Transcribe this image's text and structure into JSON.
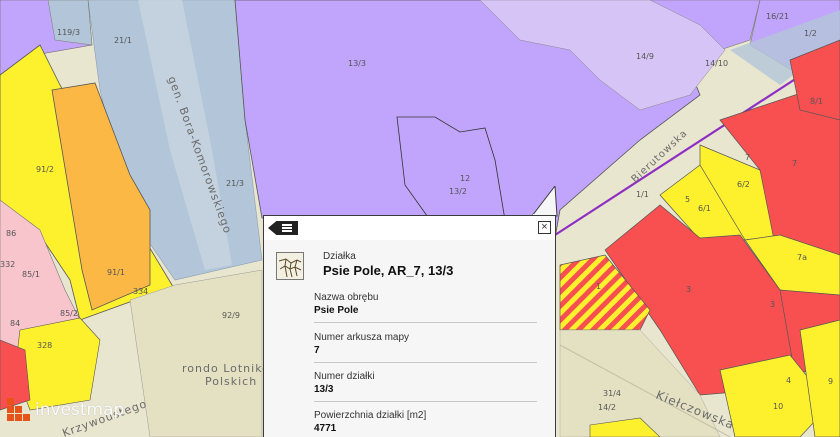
{
  "map": {
    "parcel_labels": [
      "119/3",
      "21/1",
      "13/3",
      "14/9",
      "14/10",
      "16/21",
      "1/2",
      "91/2",
      "21/3",
      "12",
      "13/2",
      "91/1",
      "334",
      "86",
      "332",
      "85/1",
      "84",
      "85/2",
      "328",
      "92/9",
      "7",
      "6/2",
      "5",
      "6/1",
      "1/1",
      "7a",
      "1",
      "3",
      "3",
      "4",
      "10",
      "31/4",
      "14/2",
      "8/1",
      "9"
    ],
    "streets": [
      "gen. Bora-Komorowskiego",
      "Bierutowska",
      "Kiełczowska",
      "rondo Lotników",
      "Polskich",
      "Krzywoustego"
    ]
  },
  "popup": {
    "category": "Działka",
    "title": "Psie Pole, AR_7, 13/3",
    "fields": [
      {
        "key": "Nazwa obrębu",
        "value": "Psie Pole"
      },
      {
        "key": "Numer arkusza mapy",
        "value": "7"
      },
      {
        "key": "Numer działki",
        "value": "13/3"
      },
      {
        "key": "Powierzchnia działki [m2]",
        "value": "4771"
      }
    ],
    "nav_icon": "list-icon",
    "close_icon": "close-icon",
    "close_glyph": "×",
    "thumbnail_icon": "parcel-map-icon"
  },
  "watermark": {
    "text": "investmap",
    "logo": "investmap-logo-icon",
    "logo_color": "#e8531a"
  },
  "colors": {
    "purple": "#c1a4fb",
    "yellow": "#fdf12e",
    "orange": "#fbb845",
    "red": "#f85050",
    "road_blue": "#b3c6d9",
    "background": "#e9e6cf",
    "pink": "#f8c5cd",
    "route_line": "#8e2fc4"
  }
}
